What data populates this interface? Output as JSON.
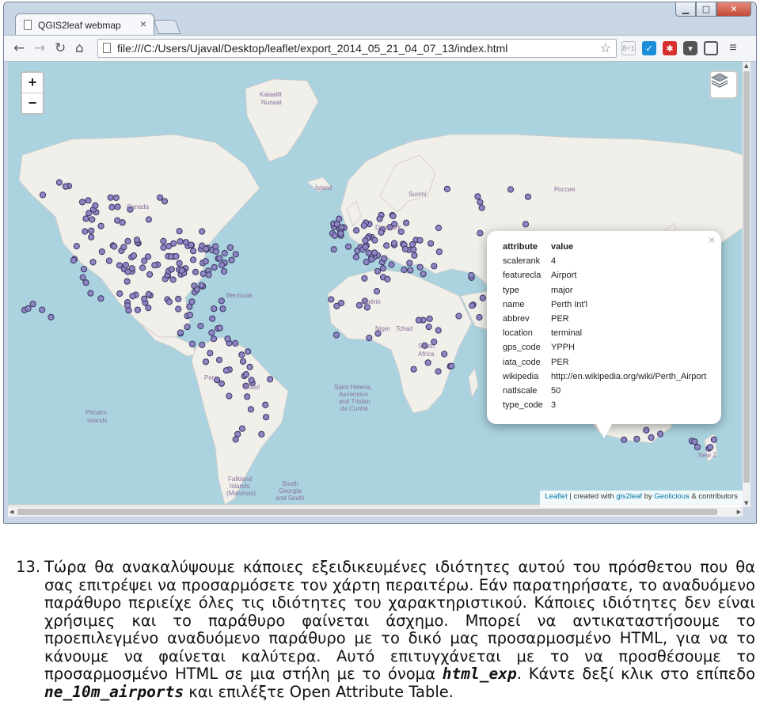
{
  "browser": {
    "tab_title": "QGIS2leaf webmap",
    "url": "file:///C:/Users/Ujaval/Desktop/leaflet/export_2014_05_21_04_07_13/index.html"
  },
  "map": {
    "labels": {
      "greenland": "Kalaallit\nNunaat",
      "canada": "Canada",
      "iceland": "Ísland",
      "russia": "Россия",
      "suomi": "Suomi",
      "danmark": "Danmark",
      "bermuda": "Bermuda",
      "algerie": "Algérie",
      "niger": "Niger",
      "tchad": "Tchad",
      "south_africa": "South\nAfrica",
      "brasil": "Brasil",
      "peru": "Peru",
      "saint_helena": "Saint Helena,\nAscension\nand Tristan\nda Cunha",
      "pitcairn": "Pitcairn\nIslands",
      "falkland": "Falkland\nIslands\n(Malvinas)",
      "south_georgia": "South\nGeorgia\nand South",
      "new_zealand": "New Z"
    },
    "zoom_in": "+",
    "zoom_out": "−",
    "attribution": {
      "leaflet": "Leaflet",
      "created_with": " | created with ",
      "gis2leaf": "gis2leaf",
      "by": " by ",
      "geolicious": "Geolicious",
      "contributors": " & contributors"
    }
  },
  "popup": {
    "headers": [
      "attribute",
      "value"
    ],
    "rows": [
      [
        "scalerank",
        "4"
      ],
      [
        "featurecla",
        "Airport"
      ],
      [
        "type",
        "major"
      ],
      [
        "name",
        "Perth Int'l"
      ],
      [
        "abbrev",
        "PER"
      ],
      [
        "location",
        "terminal"
      ],
      [
        "gps_code",
        "YPPH"
      ],
      [
        "iata_code",
        "PER"
      ],
      [
        "wikipedia",
        "http://en.wikipedia.org/wiki/Perth_Airport"
      ],
      [
        "natlscale",
        "50"
      ],
      [
        "type_code",
        "3"
      ]
    ]
  },
  "paragraph": {
    "number": "13.",
    "text_1": "Τώρα θα ανακαλύψουμε κάποιες εξειδικευμένες ιδιότητες αυτού του πρόσθετου που θα σας επιτρέψει να προσαρμόσετε τον χάρτη περαιτέρω. Εάν παρατηρήσατε, το αναδυόμενο παράθυρο περιείχε όλες τις ιδιότητες του χαρακτηριστικού. Κάποιες ιδιότητες δεν είναι χρήσιμες και το παράθυρο φαίνεται άσχημο. Μπορεί να αντικαταστήσουμε το προεπιλεγμένο αναδυόμενο παράθυρο με το δικό μας προσαρμοσμένο HTML, για να το κάνουμε να φαίνεται καλύτερα. Αυτό επιτυγχάνεται με το να προσθέσουμε το προσαρμοσμένο HTML σε μια στήλη με το όνομα ",
    "code_1": "html_exp",
    "text_2": ". Κάντε δεξί κλικ στο επίπεδο ",
    "code_2": "ne_10m_airports",
    "text_3": " και επιλέξτε Open Attribute Table."
  },
  "colors": {
    "ocean": "#aad3df",
    "land": "#f1efe9",
    "marker_fill": "#8d86c4",
    "marker_stroke": "#3a3560"
  }
}
